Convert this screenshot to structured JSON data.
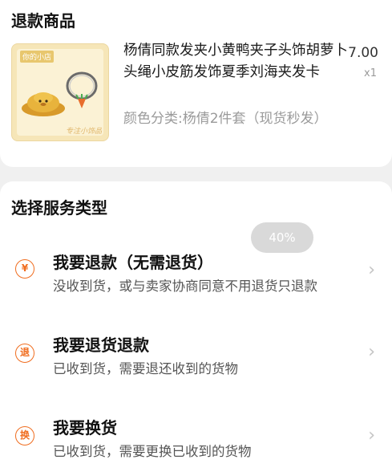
{
  "product_section": {
    "title": "退款商品",
    "item": {
      "thumb_brand": "你的小店",
      "thumb_mark": "专注小饰品",
      "title": "杨倩同款发夹小黄鸭夹子头饰胡萝卜头绳小皮筋发饰夏季刘海夹发卡",
      "sku": "颜色分类:杨倩2件套（现货秒发）",
      "price": "7.00",
      "qty": "x1"
    }
  },
  "service_section": {
    "title": "选择服务类型",
    "options": [
      {
        "icon": "refund-icon",
        "glyph": "¥",
        "title": "我要退款（无需退货）",
        "desc": "没收到货，或与卖家协商同意不用退货只退款"
      },
      {
        "icon": "return-icon",
        "glyph": "退",
        "title": "我要退货退款",
        "desc": "已收到货，需要退还收到的货物"
      },
      {
        "icon": "exchange-icon",
        "glyph": "换",
        "title": "我要换货",
        "desc": "已收到货，需要更换已收到的货物"
      }
    ]
  },
  "progress_badge": {
    "label": "40%",
    "value": 0.4
  },
  "colors": {
    "accent": "#f06d1f",
    "chevron": "#c4c4c4",
    "muted_text": "#9a9a9a"
  }
}
